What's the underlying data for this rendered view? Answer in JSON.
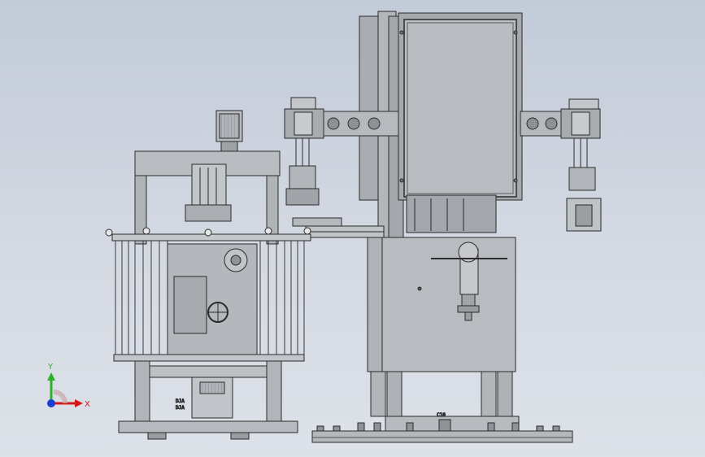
{
  "viewport": {
    "background_top": "#c2cbd8",
    "background_bottom": "#dde1e8",
    "model_fill": "#b9bcc0",
    "model_dark": "#8c8f94",
    "model_line": "#2b2b2b",
    "panel_fill": "#b7b9bd"
  },
  "triad": {
    "y_label": "Y",
    "x_label": "X",
    "y_color": "#2bb02b",
    "x_color": "#d21a1a",
    "z_color": "#1a3fd2"
  },
  "labels": {
    "sensor_top": "DJA",
    "sensor_bottom": "DJA",
    "floor_mark": "C10"
  }
}
